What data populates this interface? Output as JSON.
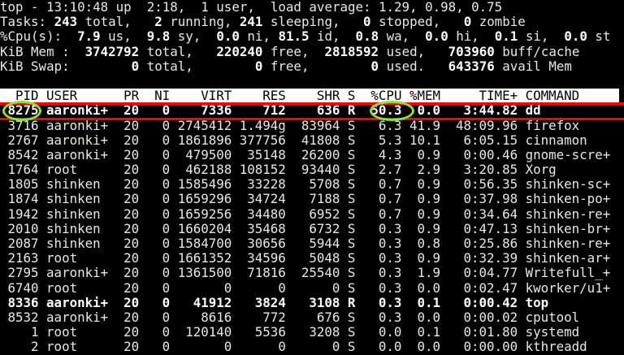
{
  "summary": [
    [
      {
        "t": "top - 13:10:48 up  2:18,  1 user,  load average: 1.29, 0.98, 0.75",
        "b": false
      }
    ],
    [
      {
        "t": "Tasks: ",
        "b": false
      },
      {
        "t": "243",
        "b": true
      },
      {
        "t": " total,   ",
        "b": false
      },
      {
        "t": "2",
        "b": true
      },
      {
        "t": " running, ",
        "b": false
      },
      {
        "t": "241",
        "b": true
      },
      {
        "t": " sleeping,   ",
        "b": false
      },
      {
        "t": "0",
        "b": true
      },
      {
        "t": " stopped,   ",
        "b": false
      },
      {
        "t": "0",
        "b": true
      },
      {
        "t": " zombie",
        "b": false
      }
    ],
    [
      {
        "t": "%Cpu(s): ",
        "b": false
      },
      {
        "t": " 7.9",
        "b": true
      },
      {
        "t": " us, ",
        "b": false
      },
      {
        "t": " 9.8",
        "b": true
      },
      {
        "t": " sy, ",
        "b": false
      },
      {
        "t": " 0.0",
        "b": true
      },
      {
        "t": " ni, ",
        "b": false
      },
      {
        "t": "81.5",
        "b": true
      },
      {
        "t": " id, ",
        "b": false
      },
      {
        "t": " 0.8",
        "b": true
      },
      {
        "t": " wa, ",
        "b": false
      },
      {
        "t": " 0.0",
        "b": true
      },
      {
        "t": " hi, ",
        "b": false
      },
      {
        "t": " 0.1",
        "b": true
      },
      {
        "t": " si, ",
        "b": false
      },
      {
        "t": " 0.0",
        "b": true
      },
      {
        "t": " st",
        "b": false
      }
    ],
    [
      {
        "t": "KiB Mem : ",
        "b": false
      },
      {
        "t": " 3742792",
        "b": true
      },
      {
        "t": " total,  ",
        "b": false
      },
      {
        "t": " 220240",
        "b": true
      },
      {
        "t": " free,  ",
        "b": false
      },
      {
        "t": "2818592",
        "b": true
      },
      {
        "t": " used,   ",
        "b": false
      },
      {
        "t": "703960",
        "b": true
      },
      {
        "t": " buff/cache",
        "b": false
      }
    ],
    [
      {
        "t": "KiB Swap: ",
        "b": false
      },
      {
        "t": "       0",
        "b": true
      },
      {
        "t": " total,  ",
        "b": false
      },
      {
        "t": "      0",
        "b": true
      },
      {
        "t": " free,  ",
        "b": false
      },
      {
        "t": "      0",
        "b": true
      },
      {
        "t": " used.   ",
        "b": false
      },
      {
        "t": "643376",
        "b": true
      },
      {
        "t": " avail Mem",
        "b": false
      }
    ]
  ],
  "columns": [
    "PID",
    "USER",
    "PR",
    "NI",
    "VIRT",
    "RES",
    "SHR",
    "S",
    "%CPU",
    "%MEM",
    "TIME+",
    "COMMAND"
  ],
  "processes": [
    {
      "bold": true,
      "cells": [
        "8275",
        "aaronki+",
        "20",
        "0",
        "7336",
        "712",
        "636",
        "R",
        "50.3",
        "0.0",
        "3:44.82",
        "dd"
      ]
    },
    {
      "bold": false,
      "cells": [
        "3716",
        "aaronki+",
        "20",
        "0",
        "2745412",
        "1.494g",
        "83964",
        "S",
        "6.3",
        "41.9",
        "48:09.96",
        "firefox"
      ]
    },
    {
      "bold": false,
      "cells": [
        "2767",
        "aaronki+",
        "20",
        "0",
        "1861896",
        "377756",
        "41808",
        "S",
        "5.3",
        "10.1",
        "6:05.15",
        "cinnamon"
      ]
    },
    {
      "bold": false,
      "cells": [
        "8542",
        "aaronki+",
        "20",
        "0",
        "479500",
        "35148",
        "26200",
        "S",
        "4.3",
        "0.9",
        "0:00.46",
        "gnome-scre+"
      ]
    },
    {
      "bold": false,
      "cells": [
        "1764",
        "root",
        "20",
        "0",
        "462188",
        "108152",
        "93440",
        "S",
        "2.7",
        "2.9",
        "3:20.85",
        "Xorg"
      ]
    },
    {
      "bold": false,
      "cells": [
        "1805",
        "shinken",
        "20",
        "0",
        "1585496",
        "33228",
        "5708",
        "S",
        "0.7",
        "0.9",
        "0:56.35",
        "shinken-sc+"
      ]
    },
    {
      "bold": false,
      "cells": [
        "1874",
        "shinken",
        "20",
        "0",
        "1659296",
        "34724",
        "7188",
        "S",
        "0.7",
        "0.9",
        "0:37.98",
        "shinken-po+"
      ]
    },
    {
      "bold": false,
      "cells": [
        "1942",
        "shinken",
        "20",
        "0",
        "1659256",
        "34480",
        "6952",
        "S",
        "0.7",
        "0.9",
        "0:34.64",
        "shinken-re+"
      ]
    },
    {
      "bold": false,
      "cells": [
        "2010",
        "shinken",
        "20",
        "0",
        "1660204",
        "35468",
        "6732",
        "S",
        "0.3",
        "0.9",
        "0:47.13",
        "shinken-br+"
      ]
    },
    {
      "bold": false,
      "cells": [
        "2087",
        "shinken",
        "20",
        "0",
        "1584700",
        "30656",
        "5944",
        "S",
        "0.3",
        "0.8",
        "0:25.86",
        "shinken-re+"
      ]
    },
    {
      "bold": false,
      "cells": [
        "2163",
        "root",
        "20",
        "0",
        "1661352",
        "34596",
        "5048",
        "S",
        "0.3",
        "0.9",
        "0:32.39",
        "shinken-ar+"
      ]
    },
    {
      "bold": false,
      "cells": [
        "2795",
        "aaronki+",
        "20",
        "0",
        "1361500",
        "71816",
        "25540",
        "S",
        "0.3",
        "1.9",
        "0:04.77",
        "Writefull_+"
      ]
    },
    {
      "bold": false,
      "cells": [
        "6740",
        "root",
        "20",
        "0",
        "0",
        "0",
        "0",
        "S",
        "0.3",
        "0.0",
        "0:02.47",
        "kworker/u1+"
      ]
    },
    {
      "bold": true,
      "cells": [
        "8336",
        "aaronki+",
        "20",
        "0",
        "41912",
        "3824",
        "3108",
        "R",
        "0.3",
        "0.1",
        "0:00.42",
        "top"
      ]
    },
    {
      "bold": false,
      "cells": [
        "8532",
        "aaronki+",
        "20",
        "0",
        "8616",
        "772",
        "676",
        "S",
        "0.3",
        "0.0",
        "0:00.02",
        "cputool"
      ]
    },
    {
      "bold": false,
      "cells": [
        "1",
        "root",
        "20",
        "0",
        "120140",
        "5536",
        "3208",
        "S",
        "0.0",
        "0.1",
        "0:01.80",
        "systemd"
      ]
    },
    {
      "bold": false,
      "cells": [
        "2",
        "root",
        "20",
        "0",
        "0",
        "0",
        "0",
        "S",
        "0.0",
        "0.0",
        "0:00.00",
        "kthreadd"
      ]
    }
  ],
  "colors": {
    "highlight": "#ff0000",
    "circle": "#8ee02a",
    "header_bg": "#ffffff"
  }
}
